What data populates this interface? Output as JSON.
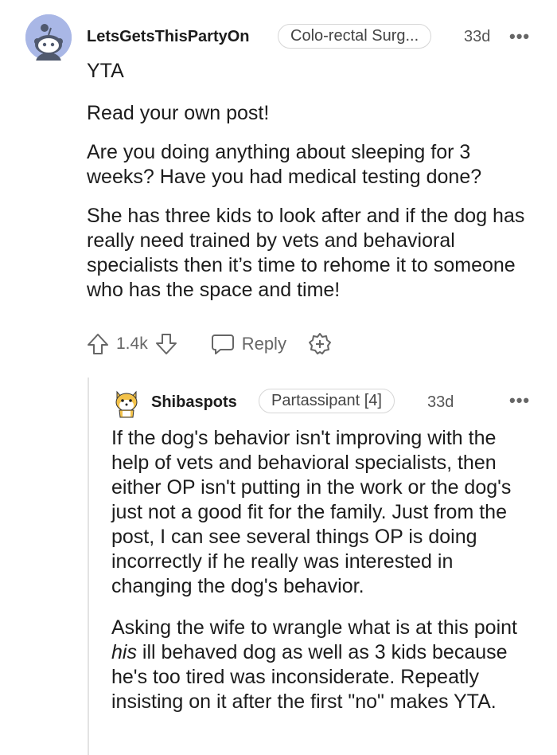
{
  "comment1": {
    "username": "LetsGetsThisPartyOn",
    "flair": "Colo-rectal Surg...",
    "time": "33d",
    "more": "•••",
    "paragraphs": [
      "YTA",
      "Read your own post!",
      "Are you doing anything about sleeping for 3 weeks? Have you had medical testing done?",
      "She has three kids to look after and if the dog has really need trained by vets and behavioral specialists then it’s time to rehome it to someone who has the space and time!"
    ],
    "votes": "1.4k",
    "reply_label": "Reply"
  },
  "comment2": {
    "username": "Shibaspots",
    "flair": "Partassipant [4]",
    "time": "33d",
    "more": "•••",
    "paragraph1": "If the dog's behavior isn't improving with the help of vets and behavioral specialists, then either OP isn't putting in the work or the dog's just not a good fit for the family. Just from the post, I can see several things OP is doing incorrectly if he really was interested in changing the dog's behavior.",
    "paragraph2_before": "Asking the wife to wrangle what is at this point ",
    "paragraph2_italic": "his",
    "paragraph2_after": " ill behaved dog as well as 3 kids because he's too tired was inconsiderate. Repeatly insisting on it after the first \"no\" makes YTA."
  },
  "colors": {
    "avatar_bg": "#a9b7e6",
    "text": "#1c1c1c",
    "muted": "#666666"
  },
  "icons": [
    "snoo-avatar-icon",
    "upvote-icon",
    "downvote-icon",
    "reply-icon",
    "award-icon",
    "shiba-avatar-icon"
  ]
}
